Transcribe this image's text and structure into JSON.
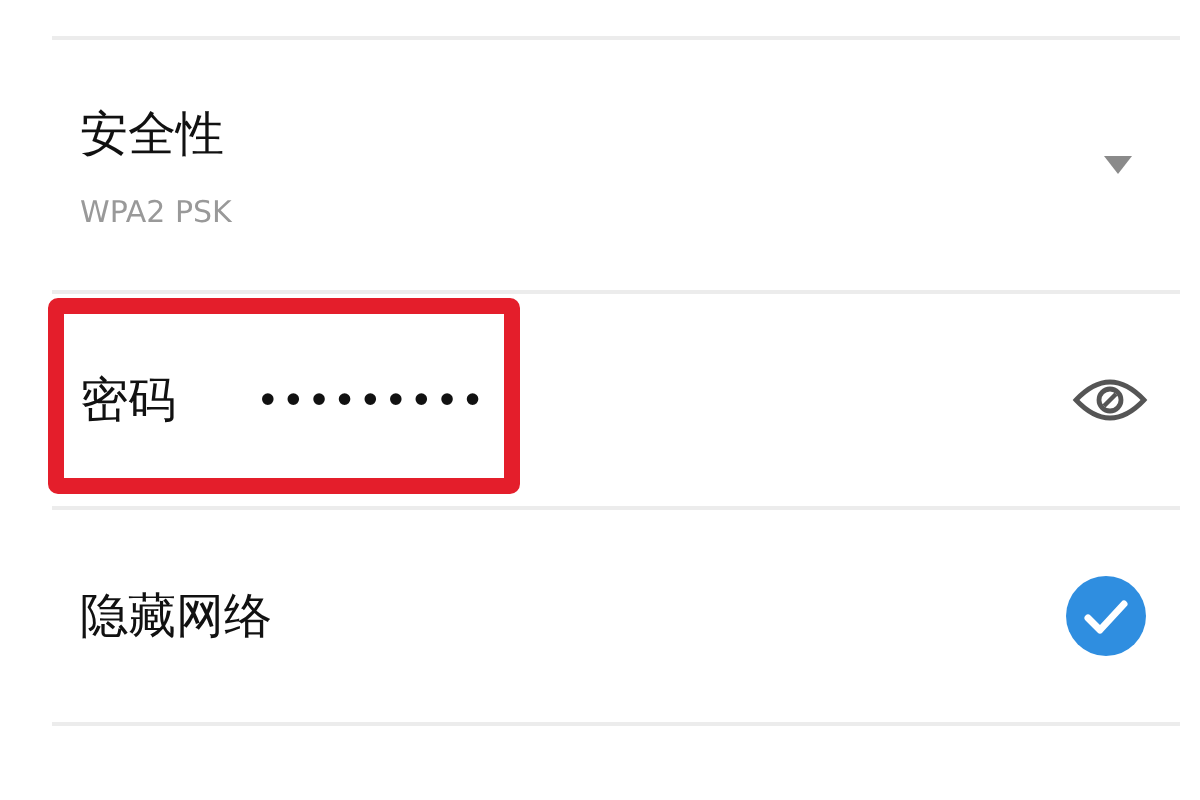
{
  "security": {
    "label": "安全性",
    "value": "WPA2 PSK"
  },
  "password": {
    "label": "密码",
    "value": "•••••••••",
    "highlighted": true
  },
  "hidden_network": {
    "label": "隐藏网络",
    "checked": true
  }
}
